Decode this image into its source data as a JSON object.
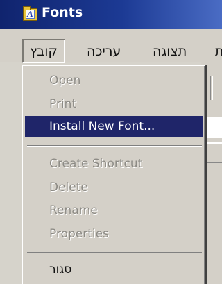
{
  "window": {
    "title": "Fonts",
    "title_icon": "fonts-folder-icon"
  },
  "menubar": {
    "items": [
      "קובץ",
      "עריכה",
      "תצוגה",
      "ת"
    ],
    "active_index": 0
  },
  "file_menu": {
    "items": [
      {
        "label": "Open",
        "enabled": false
      },
      {
        "label": "Print",
        "enabled": false
      },
      {
        "label": "Install New Font...",
        "enabled": true,
        "highlighted": true
      },
      {
        "label": "Create Shortcut",
        "enabled": false
      },
      {
        "label": "Delete",
        "enabled": false
      },
      {
        "label": "Rename",
        "enabled": false
      },
      {
        "label": "Properties",
        "enabled": false
      },
      {
        "label": "סגור",
        "enabled": true
      }
    ]
  },
  "colors": {
    "title_bar": "#10246e",
    "highlight": "#1f2569",
    "menu_bg": "#d4d0c8",
    "disabled_text": "#8d8b85"
  }
}
